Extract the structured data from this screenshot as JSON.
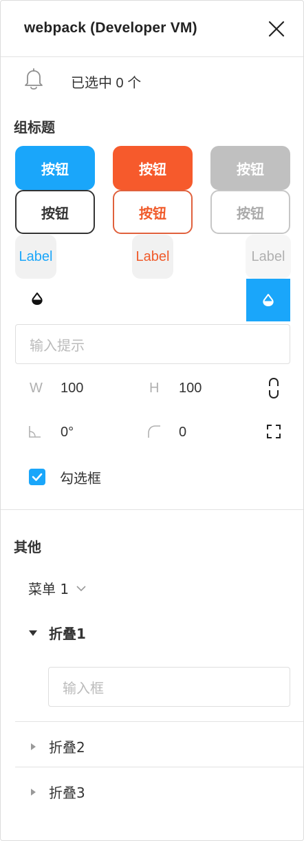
{
  "window": {
    "title": "webpack (Developer VM)"
  },
  "notice": {
    "selected_text": "已选中 0 个"
  },
  "group": {
    "title": "组标题",
    "buttons_filled": [
      "按钮",
      "按钮",
      "按钮"
    ],
    "buttons_outline": [
      "按钮",
      "按钮",
      "按钮"
    ],
    "labels": [
      "Label",
      "Label",
      "Label"
    ],
    "input_placeholder": "输入提示",
    "props": {
      "w_label": "W",
      "w_value": "100",
      "h_label": "H",
      "h_value": "100",
      "angle_value": "0°",
      "radius_value": "0"
    },
    "checkbox_label": "勾选框"
  },
  "other": {
    "title": "其他",
    "menu_label": "菜单 1",
    "collapses": [
      {
        "label": "折叠1",
        "expanded": true,
        "input_placeholder": "输入框"
      },
      {
        "label": "折叠2",
        "expanded": false
      },
      {
        "label": "折叠3",
        "expanded": false
      }
    ]
  },
  "colors": {
    "accent": "#1aa6fa",
    "danger": "#f65a2c",
    "disabled": "#c0c0c0"
  }
}
